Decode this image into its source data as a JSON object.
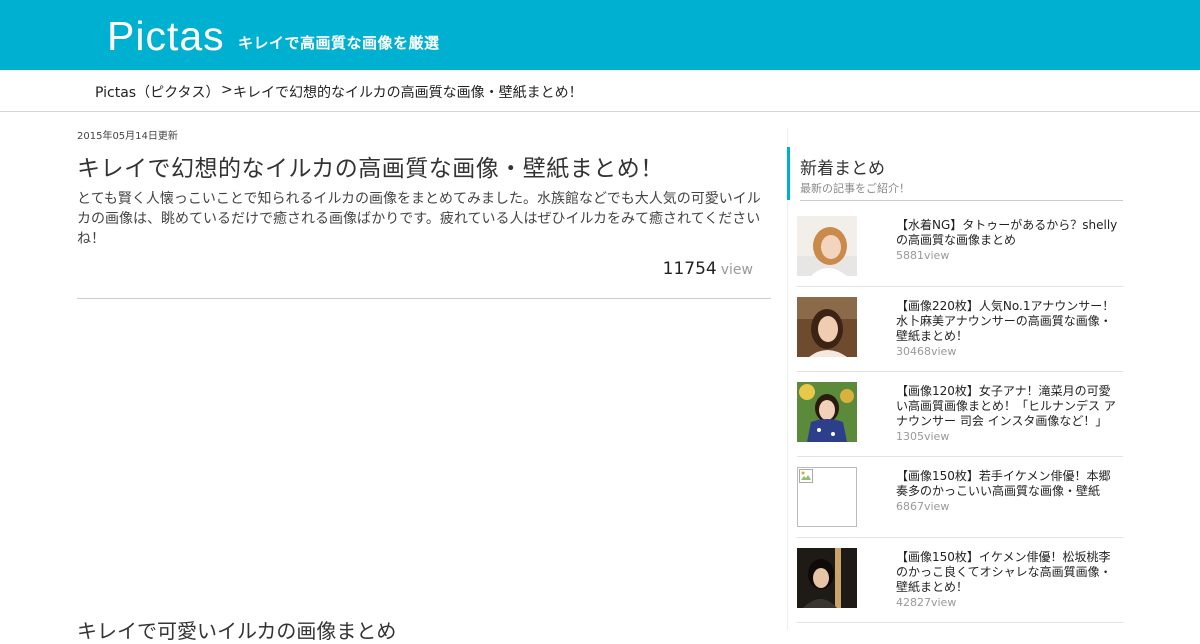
{
  "site": {
    "logo": "Pictas",
    "tagline": "キレイで高画質な画像を厳選"
  },
  "breadcrumb": {
    "home": "Pictas（ピクタス）",
    "separator": ">",
    "current": "キレイで幻想的なイルカの高画質な画像・壁紙まとめ！"
  },
  "article": {
    "date": "2015年05月14日更新",
    "title": "キレイで幻想的なイルカの高画質な画像・壁紙まとめ！",
    "description": "とても賢く人懐っこいことで知られるイルカの画像をまとめてみました。水族館などでも大人気の可愛いイルカの画像は、眺めているだけで癒される画像ばかりです。疲れている人はぜひイルカをみて癒されてくださいね！",
    "view_count": "11754",
    "view_unit": "view",
    "section_heading": "キレイで可愛いイルカの画像まとめ"
  },
  "sidebar": {
    "title": "新着まとめ",
    "subtitle": "最新の記事をご紹介！",
    "items": [
      {
        "title": "【水着NG】タトゥーがあるから？shellyの高画質な画像まとめ",
        "views": "5881view"
      },
      {
        "title": "【画像220枚】人気No.1アナウンサー！水卜麻美アナウンサーの高画質な画像・壁紙まとめ！",
        "views": "30468view"
      },
      {
        "title": "【画像120枚】女子アナ！滝菜月の可愛い高画質画像まとめ！「ヒルナンデス アナウンサー 司会 インスタ画像など！」",
        "views": "1305view"
      },
      {
        "title": "【画像150枚】若手イケメン俳優！本郷奏多のかっこいい高画質な画像・壁紙",
        "views": "6867view"
      },
      {
        "title": "【画像150枚】イケメン俳優！松坂桃李のかっこ良くてオシャレな高画質画像・壁紙まとめ！",
        "views": "42827view"
      }
    ]
  },
  "colors": {
    "brand": "#00b0d0",
    "text": "#333333",
    "muted": "#999999"
  }
}
